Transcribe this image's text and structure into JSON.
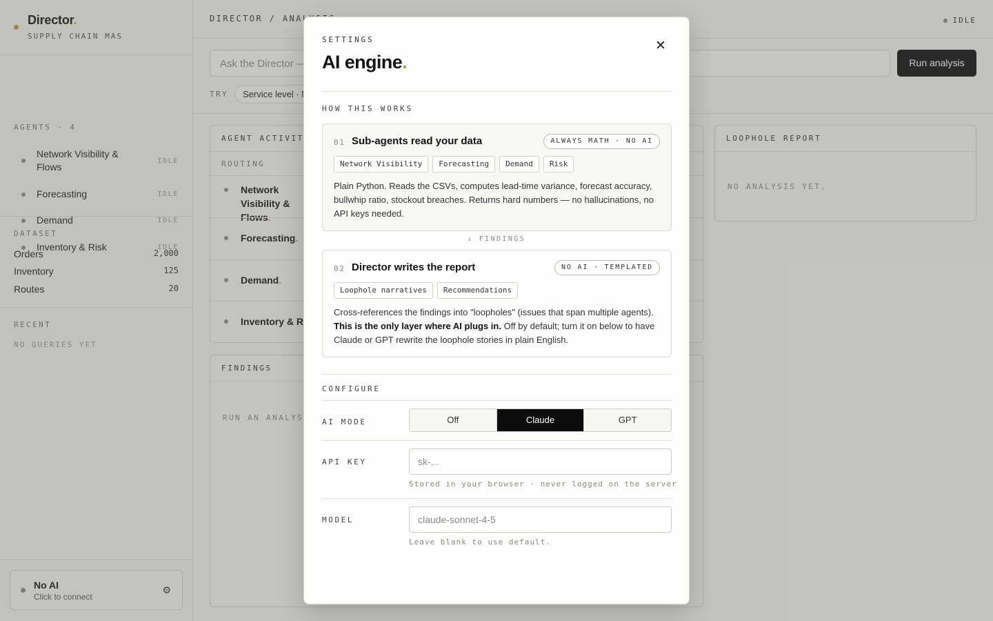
{
  "sidebar": {
    "brand_name": "Director",
    "brand_accent": ".",
    "brand_subtitle": "SUPPLY CHAIN MAS",
    "agents_label": "AGENTS · 4",
    "agents": [
      {
        "label": "Network Visibility & Flows",
        "status": "IDLE"
      },
      {
        "label": "Forecasting",
        "status": "IDLE"
      },
      {
        "label": "Demand",
        "status": "IDLE"
      },
      {
        "label": "Inventory & Risk",
        "status": "IDLE"
      }
    ],
    "dataset_label": "DATASET",
    "dataset": [
      {
        "label": "Orders",
        "value": "2,000"
      },
      {
        "label": "Inventory",
        "value": "125"
      },
      {
        "label": "Routes",
        "value": "20"
      }
    ],
    "recent_label": "RECENT",
    "recent_empty": "NO QUERIES YET",
    "ai_card": {
      "title": "No AI",
      "subtitle": "Click to connect",
      "icon": "gear-icon"
    }
  },
  "topbar": {
    "breadcrumb": "DIRECTOR / ANALYSIS",
    "status": "IDLE"
  },
  "query": {
    "placeholder": "Ask the Director —",
    "run_label": "Run analysis",
    "try_label": "TRY",
    "chip": "Service level · N"
  },
  "activity": {
    "header": "AGENT ACTIVITY",
    "routing": "ROUTING",
    "agents": [
      "Network Visibility & Flows",
      "Forecasting",
      "Demand",
      "Inventory & Risk"
    ],
    "accent": "."
  },
  "loophole": {
    "header": "LOOPHOLE REPORT",
    "empty": "NO ANALYSIS YET."
  },
  "findings": {
    "header": "FINDINGS",
    "hint": "RUN AN ANALYSIS"
  },
  "modal": {
    "eyebrow": "SETTINGS",
    "title": "AI engine",
    "title_accent": ".",
    "close_icon": "close-icon",
    "how_label": "HOW THIS WORKS",
    "step1": {
      "num": "01",
      "title": "Sub-agents read your data",
      "pill": "ALWAYS MATH · NO AI",
      "tags": [
        "Network Visibility",
        "Forecasting",
        "Demand",
        "Risk"
      ],
      "desc": "Plain Python. Reads the CSVs, computes lead-time variance, forecast accuracy, bullwhip ratio, stockout breaches. Returns hard numbers — no hallucinations, no API keys needed."
    },
    "arrow_label": "↓ FINDINGS",
    "step2": {
      "num": "02",
      "title": "Director writes the report",
      "pill": "NO AI · TEMPLATED",
      "tags": [
        "Loophole narratives",
        "Recommendations"
      ],
      "desc_pre": "Cross-references the findings into \"loopholes\" (issues that span multiple agents).",
      "desc_bold": "This is the only layer where AI plugs in.",
      "desc_post": "Off by default; turn it on below to have Claude or GPT rewrite the loophole stories in plain English."
    },
    "configure_label": "CONFIGURE",
    "ai_mode": {
      "label": "AI MODE",
      "options": [
        "Off",
        "Claude",
        "GPT"
      ],
      "selected": "Claude"
    },
    "api_key": {
      "label": "API KEY",
      "value": "",
      "placeholder": "sk-...",
      "help": "Stored in your browser · never logged on the server"
    },
    "model": {
      "label": "MODEL",
      "value": "",
      "placeholder": "claude-sonnet-4-5",
      "help": "Leave blank to use default."
    }
  },
  "colors": {
    "accent": "#b59a55",
    "primary": "#111111"
  }
}
